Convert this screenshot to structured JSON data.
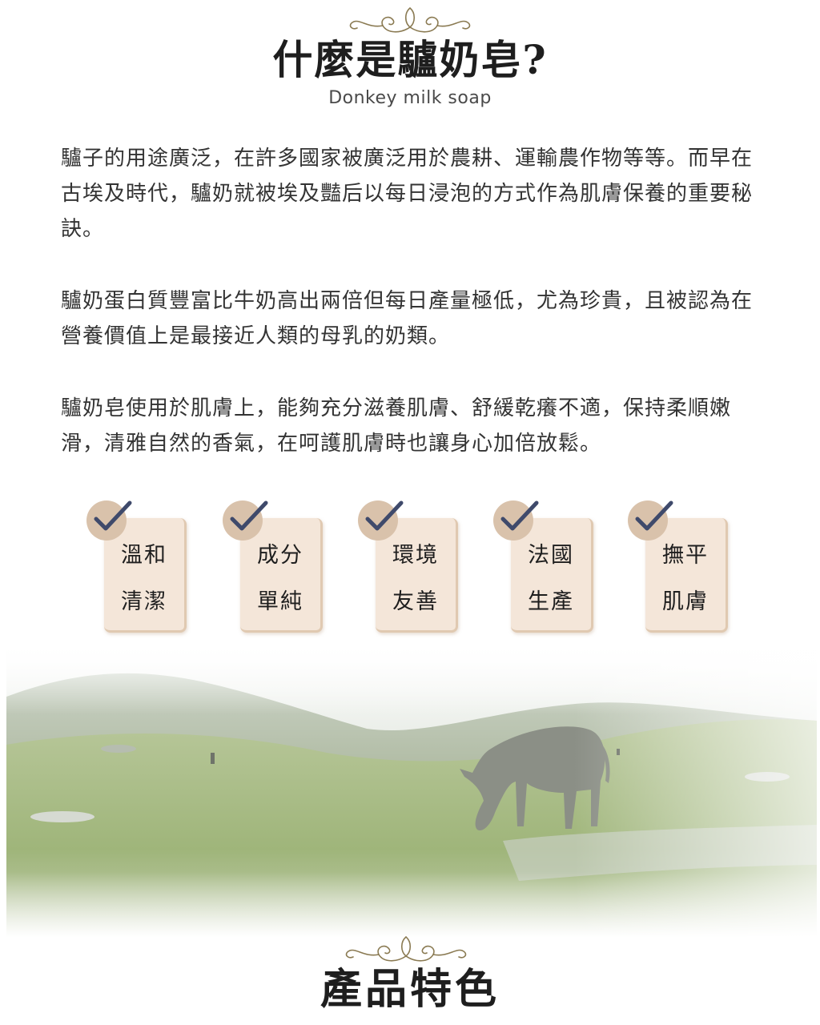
{
  "intro": {
    "title": "什麼是驢奶皂?",
    "subtitle": "Donkey milk soap"
  },
  "paragraphs": [
    "驢子的用途廣泛，在許多國家被廣泛用於農耕、運輸農作物等等。而早在古埃及時代，驢奶就被埃及豔后以每日浸泡的方式作為肌膚保養的重要秘訣。",
    "驢奶蛋白質豐富比牛奶高出兩倍但每日產量極低，尤為珍貴，且被認為在營養價值上是最接近人類的母乳的奶類。",
    "驢奶皂使用於肌膚上，能夠充分滋養肌膚、舒緩乾癢不適，保持柔順嫩滑，清雅自然的香氣，在呵護肌膚時也讓身心加倍放鬆。"
  ],
  "features": [
    {
      "line1": "溫和",
      "line2": "清潔"
    },
    {
      "line1": "成分",
      "line2": "單純"
    },
    {
      "line1": "環境",
      "line2": "友善"
    },
    {
      "line1": "法國",
      "line2": "生產"
    },
    {
      "line1": "撫平",
      "line2": "肌膚"
    }
  ],
  "section2": {
    "title": "產品特色"
  },
  "colors": {
    "check": "#3f4a6b",
    "card": "#f4e6d9",
    "ornament": "#8a7a52"
  },
  "icons": [
    "ornament-flourish-icon",
    "checkmark-icon",
    "landscape-donkey-image"
  ]
}
